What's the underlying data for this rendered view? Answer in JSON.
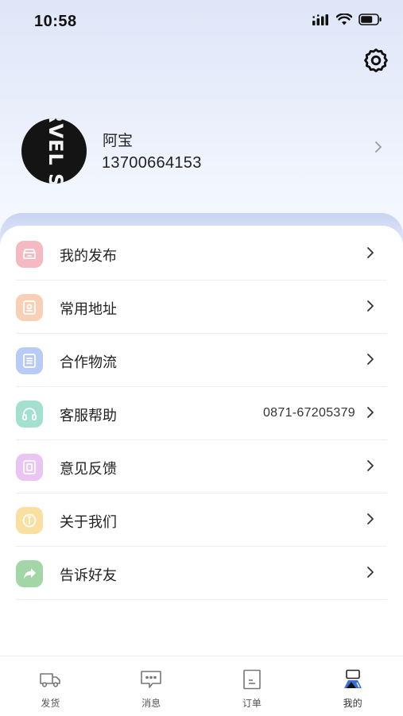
{
  "status_bar": {
    "time": "10:58"
  },
  "profile": {
    "name": "阿宝",
    "phone": "13700664153",
    "avatar_text": "RVEL STUD"
  },
  "menu": [
    {
      "label": "我的发布",
      "icon": "publish-icon",
      "color": "#f3a1ad",
      "value": ""
    },
    {
      "label": "常用地址",
      "icon": "address-icon",
      "color": "#f6c3a2",
      "value": ""
    },
    {
      "label": "合作物流",
      "icon": "logistics-icon",
      "color": "#a8c0f5",
      "value": ""
    },
    {
      "label": "客服帮助",
      "icon": "headset-icon",
      "color": "#8fd9c6",
      "value": "0871-67205379"
    },
    {
      "label": "意见反馈",
      "icon": "feedback-icon",
      "color": "#e3b3ef",
      "value": ""
    },
    {
      "label": "关于我们",
      "icon": "info-icon",
      "color": "#f7d88c",
      "value": ""
    },
    {
      "label": "告诉好友",
      "icon": "share-icon",
      "color": "#8fcf93",
      "value": ""
    }
  ],
  "tabbar": [
    {
      "label": "发货",
      "icon": "truck-icon"
    },
    {
      "label": "消息",
      "icon": "message-icon"
    },
    {
      "label": "订单",
      "icon": "order-icon"
    },
    {
      "label": "我的",
      "icon": "profile-icon",
      "active": true
    }
  ]
}
